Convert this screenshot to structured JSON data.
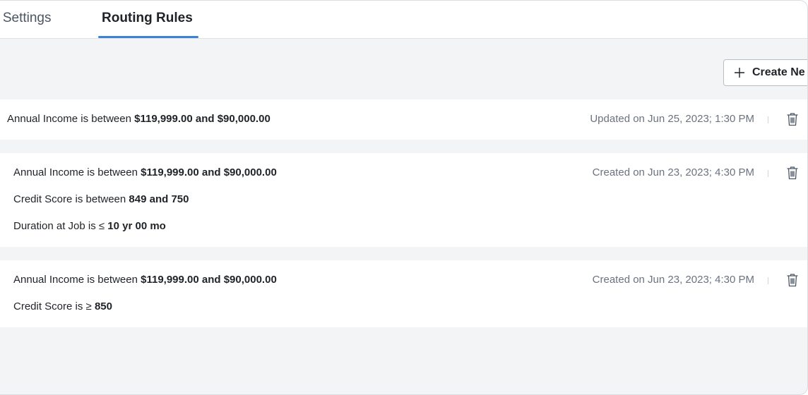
{
  "tabs": [
    {
      "label": "g Settings",
      "active": false
    },
    {
      "label": "Routing Rules",
      "active": true
    }
  ],
  "toolbar": {
    "create_label": "Create Ne",
    "icon": "plus-icon"
  },
  "colors": {
    "accent": "#3b82d6",
    "background": "#f3f4f6",
    "muted_text": "#6b7280"
  },
  "rules": [
    {
      "conditions": [
        {
          "prefix": "Annual Income is between ",
          "value": "$119,999.00 and $90,000.00"
        }
      ],
      "meta": "Updated on Jun 25, 2023; 1:30 PM",
      "icon": "trash-icon"
    },
    {
      "conditions": [
        {
          "prefix": "Annual Income is between ",
          "value": "$119,999.00 and $90,000.00"
        },
        {
          "prefix": "Credit Score is between ",
          "value": "849 and 750"
        },
        {
          "prefix": "Duration at Job is ≤ ",
          "value": "10 yr 00 mo"
        }
      ],
      "meta": "Created on Jun 23, 2023; 4:30 PM",
      "icon": "trash-icon"
    },
    {
      "conditions": [
        {
          "prefix": "Annual Income is between ",
          "value": "$119,999.00 and $90,000.00"
        },
        {
          "prefix": "Credit Score is ≥ ",
          "value": "850"
        }
      ],
      "meta": "Created on Jun 23, 2023; 4:30 PM",
      "icon": "trash-icon"
    }
  ]
}
